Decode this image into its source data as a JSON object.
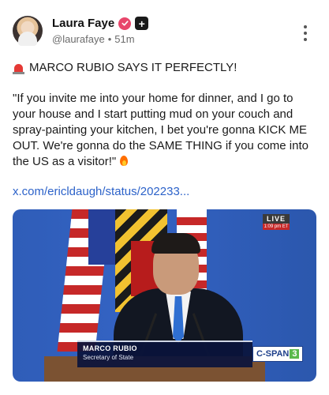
{
  "post": {
    "author_name": "Laura Faye",
    "handle": "@laurafaye",
    "separator": "•",
    "time_ago": "51m",
    "plus_badge": "+",
    "headline": "MARCO RUBIO SAYS IT PERFECTLY!",
    "body": "\"If you invite me into your home for dinner, and I go to your house and I start putting mud on your couch and spray-painting your kitchen, I bet you're gonna KICK ME OUT. We're gonna do the SAME THING if you come into the US as a visitor!\"",
    "link_text": "x.com/ericldaugh/status/202233..."
  },
  "icons": {
    "verified": "verified-check-icon",
    "plus": "plus-badge-icon",
    "more": "more-vertical-icon",
    "siren": "siren-emoji-icon",
    "fire": "fire-emoji-icon"
  },
  "media": {
    "live_label": "LIVE",
    "live_time": "1:09 pm ET",
    "lower_third_name": "MARCO RUBIO",
    "lower_third_title": "Secretary of State",
    "network": "C-SPAN",
    "network_number": "3"
  },
  "colors": {
    "verified": "#e8466b",
    "link": "#2c62c9",
    "network_accent": "#5ab94c"
  }
}
